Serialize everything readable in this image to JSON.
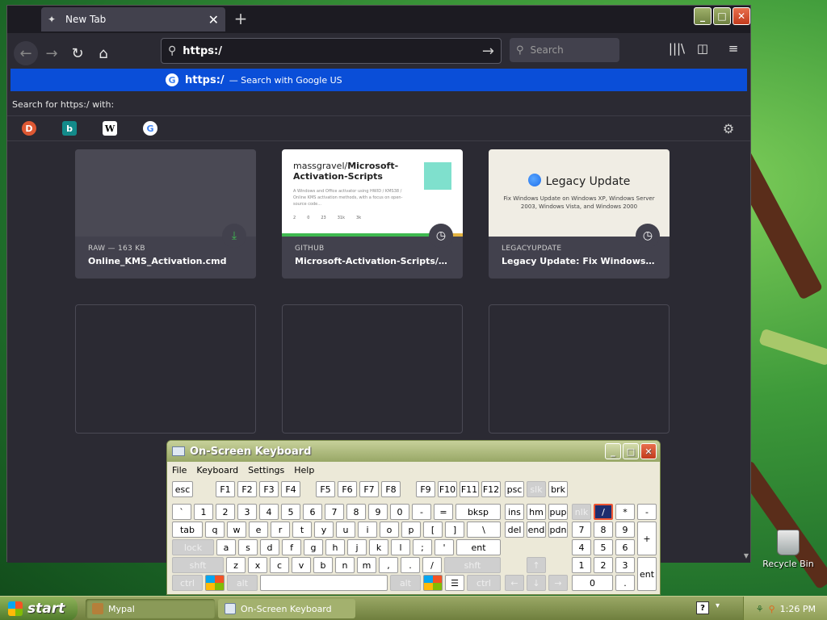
{
  "browser": {
    "tab": {
      "title": "New Tab",
      "close": "✕"
    },
    "new_tab_symbol": "+",
    "window_buttons": {
      "minimize": "_",
      "maximize": "□",
      "close": "✕"
    },
    "nav": {
      "back": "←",
      "forward": "→",
      "reload": "↻",
      "home": "⌂"
    },
    "url": {
      "value": "https:/",
      "go": "→"
    },
    "search": {
      "placeholder": "Search"
    },
    "toolbar": {
      "library": "|||\\",
      "sidebar": "◫",
      "menu": "≡"
    },
    "suggestion": {
      "query": "https:/",
      "hint": "— Search with Google US"
    },
    "search_with_label": "Search for https:/ with:",
    "engines": [
      {
        "name": "duckduckgo",
        "glyph": "D",
        "color": "#de5833"
      },
      {
        "name": "bing",
        "glyph": "b",
        "color": "#138a8a"
      },
      {
        "name": "wikipedia",
        "glyph": "W",
        "color": "#ffffff"
      },
      {
        "name": "google",
        "glyph": "G",
        "color": "#4285f4"
      }
    ],
    "settings_icon": "⚙",
    "tiles": [
      {
        "source": "RAW — 163 KB",
        "name": "Online_KMS_Activation.cmd",
        "badge": "⤓"
      },
      {
        "source": "GITHUB",
        "name": "Microsoft-Activation-Scripts/On...",
        "badge": "◷",
        "thumb": {
          "owner": "massgravel/",
          "repo_a": "Microsoft-",
          "repo_b": "Activation-Scripts",
          "desc": "A Windows and Office activator using HWID / KMS38 / Online KMS activation methods, with a focus on open-source code...",
          "stats": [
            "2",
            "0",
            "23",
            "31k",
            "3k"
          ]
        }
      },
      {
        "source": "LEGACYUPDATE",
        "name": "Legacy Update: Fix Windows Up...",
        "badge": "◷",
        "thumb": {
          "title": "Legacy Update",
          "subtitle": "Fix Windows Update on Windows XP, Windows Server 2003, Windows Vista, and Windows 2000"
        }
      }
    ]
  },
  "desktop": {
    "recycle_bin": "Recycle Bin"
  },
  "osk": {
    "title": "On-Screen Keyboard",
    "menu": [
      "File",
      "Keyboard",
      "Settings",
      "Help"
    ],
    "window_buttons": {
      "minimize": "_",
      "maximize": "□",
      "close": "✕"
    },
    "keys": {
      "row0": [
        "esc",
        "F1",
        "F2",
        "F3",
        "F4",
        "F5",
        "F6",
        "F7",
        "F8",
        "F9",
        "F10",
        "F11",
        "F12",
        "psc",
        "slk",
        "brk"
      ],
      "row1": [
        "`",
        "1",
        "2",
        "3",
        "4",
        "5",
        "6",
        "7",
        "8",
        "9",
        "0",
        "-",
        "=",
        "bksp",
        "ins",
        "hm",
        "pup",
        "nlk",
        "/",
        "*",
        "-"
      ],
      "row2": [
        "tab",
        "q",
        "w",
        "e",
        "r",
        "t",
        "y",
        "u",
        "i",
        "o",
        "p",
        "[",
        "]",
        "\\",
        "del",
        "end",
        "pdn",
        "7",
        "8",
        "9",
        "+"
      ],
      "row3": [
        "lock",
        "a",
        "s",
        "d",
        "f",
        "g",
        "h",
        "j",
        "k",
        "l",
        ";",
        "'",
        "ent",
        "4",
        "5",
        "6"
      ],
      "row4": [
        "shft",
        "z",
        "x",
        "c",
        "v",
        "b",
        "n",
        "m",
        ",",
        ".",
        "/",
        "shft",
        "↑",
        "1",
        "2",
        "3",
        "ent"
      ],
      "row5": [
        "ctrl",
        "alt",
        "alt",
        "ctrl",
        "←",
        "↓",
        "→",
        "0",
        "."
      ]
    }
  },
  "taskbar": {
    "start": "start",
    "tasks": [
      "Mypal",
      "On-Screen Keyboard"
    ],
    "help": "?",
    "chevron": "▾",
    "clock": "1:26 PM"
  }
}
